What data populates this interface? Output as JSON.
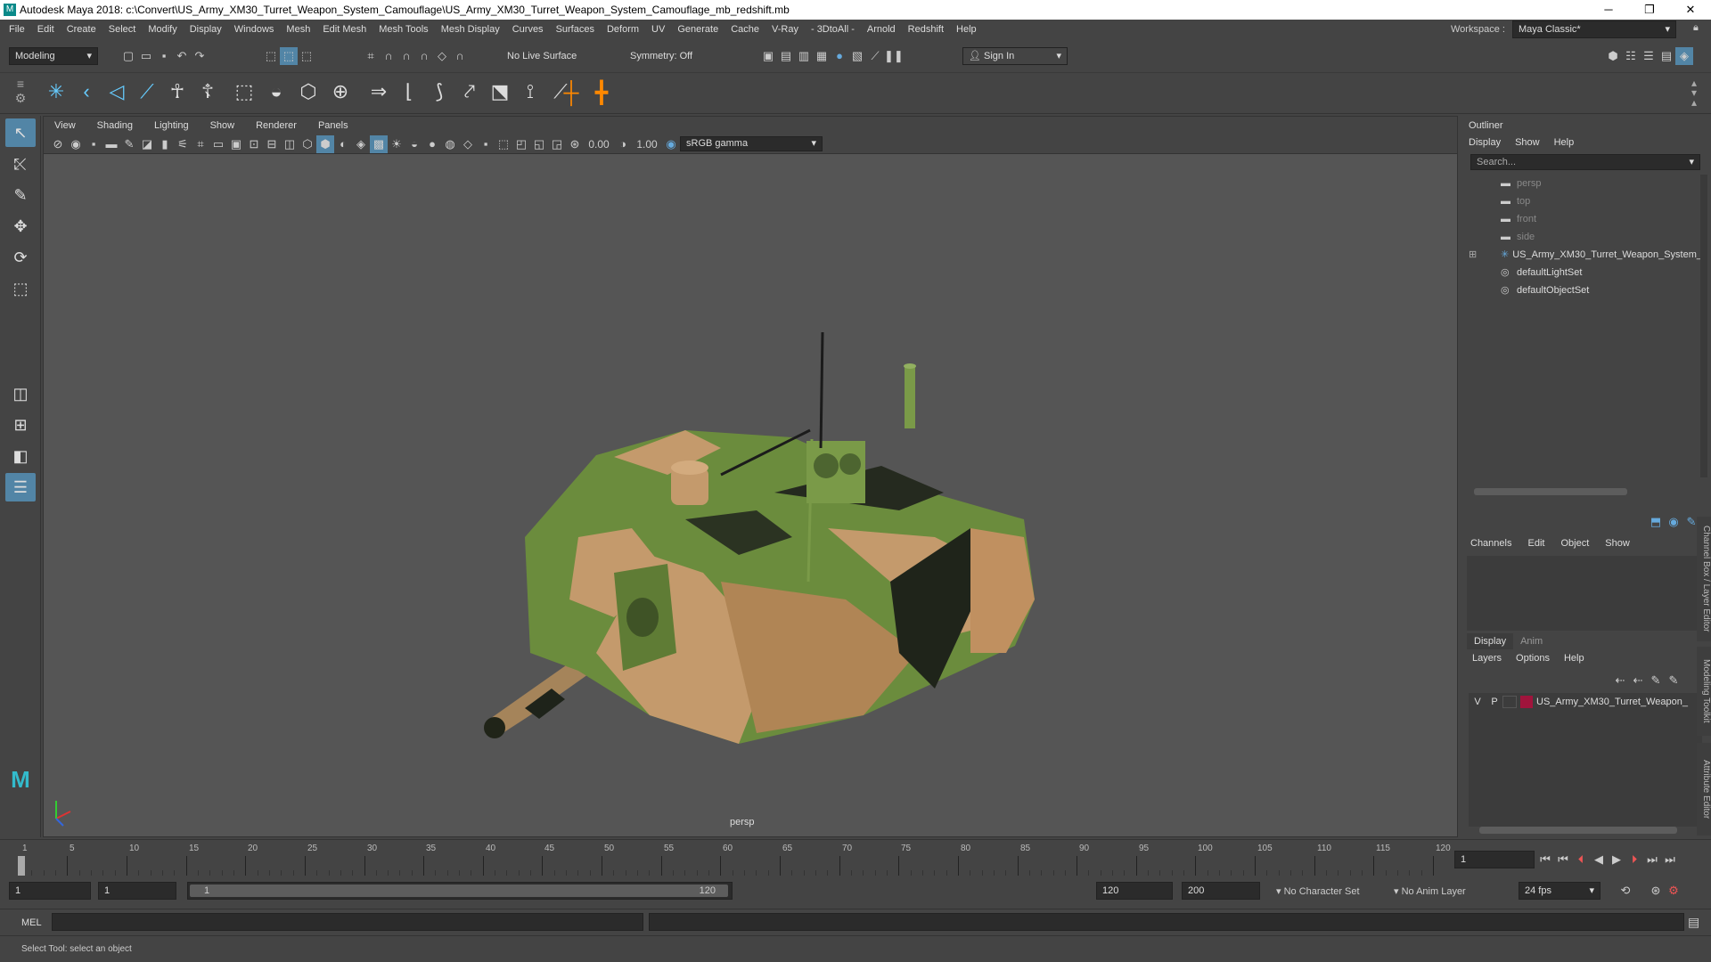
{
  "window": {
    "title": "Autodesk Maya 2018: c:\\Convert\\US_Army_XM30_Turret_Weapon_System_Camouflage\\US_Army_XM30_Turret_Weapon_System_Camouflage_mb_redshift.mb",
    "minimize": "─",
    "maximize": "❐",
    "close": "✕"
  },
  "menubar": {
    "items": [
      "File",
      "Edit",
      "Create",
      "Select",
      "Modify",
      "Display",
      "Windows",
      "Mesh",
      "Edit Mesh",
      "Mesh Tools",
      "Mesh Display",
      "Curves",
      "Surfaces",
      "Deform",
      "UV",
      "Generate",
      "Cache",
      "V-Ray",
      "- 3DtoAll -",
      "Arnold",
      "Redshift",
      "Help"
    ],
    "workspace_label": "Workspace :",
    "workspace_value": "Maya Classic*"
  },
  "statusline": {
    "mode": "Modeling",
    "live_surface": "No Live Surface",
    "symmetry": "Symmetry: Off",
    "sign_in": "Sign In"
  },
  "panel": {
    "menu": [
      "View",
      "Shading",
      "Lighting",
      "Show",
      "Renderer",
      "Panels"
    ],
    "exposure": "0.00",
    "gamma": "1.00",
    "color_space": "sRGB gamma",
    "camera_label": "persp"
  },
  "outliner": {
    "title": "Outliner",
    "menu": [
      "Display",
      "Show",
      "Help"
    ],
    "search_placeholder": "Search...",
    "items": [
      {
        "label": "persp",
        "dim": true
      },
      {
        "label": "top",
        "dim": true
      },
      {
        "label": "front",
        "dim": true
      },
      {
        "label": "side",
        "dim": true
      },
      {
        "label": "US_Army_XM30_Turret_Weapon_System_",
        "dim": false
      },
      {
        "label": "defaultLightSet",
        "dim": false
      },
      {
        "label": "defaultObjectSet",
        "dim": false
      }
    ]
  },
  "channelbox": {
    "menu": [
      "Channels",
      "Edit",
      "Object",
      "Show"
    ]
  },
  "layereditor": {
    "tabs": [
      "Display",
      "Anim"
    ],
    "menu": [
      "Layers",
      "Options",
      "Help"
    ],
    "layer": {
      "v": "V",
      "p": "P",
      "name": "US_Army_XM30_Turret_Weapon_",
      "color": "#a0143c"
    }
  },
  "side_tabs": [
    "Channel Box / Layer Editor",
    "Modeling Toolkit",
    "Attribute Editor"
  ],
  "timeslider": {
    "ticks": [
      1,
      5,
      10,
      15,
      20,
      25,
      30,
      35,
      40,
      45,
      50,
      55,
      60,
      65,
      70,
      75,
      80,
      85,
      90,
      95,
      100,
      105,
      110,
      115,
      120
    ],
    "current_frame": "1"
  },
  "rangeslider": {
    "start": "1",
    "playback_start": "1",
    "range_start": "1",
    "range_end": "120",
    "playback_end": "120",
    "end": "200",
    "character_set": "No Character Set",
    "anim_layer": "No Anim Layer",
    "fps": "24 fps"
  },
  "cmdline": {
    "label": "MEL"
  },
  "helpline": {
    "text": "Select Tool: select an object"
  }
}
